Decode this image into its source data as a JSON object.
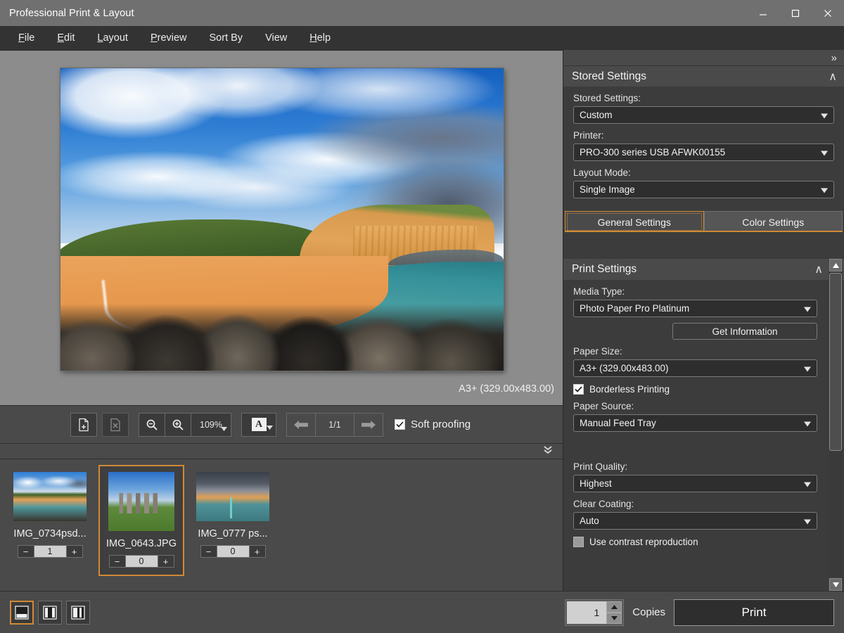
{
  "window": {
    "title": "Professional Print & Layout",
    "minimize_label": "Minimize",
    "maximize_label": "Maximize",
    "close_label": "Close"
  },
  "menubar": {
    "items": [
      {
        "label": "File",
        "accel": "F"
      },
      {
        "label": "Edit",
        "accel": "E"
      },
      {
        "label": "Layout",
        "accel": "L"
      },
      {
        "label": "Preview",
        "accel": "P"
      },
      {
        "label": "Sort By",
        "accel": ""
      },
      {
        "label": "View",
        "accel": ""
      },
      {
        "label": "Help",
        "accel": "H"
      }
    ]
  },
  "preview": {
    "paper_size_label": "A3+ (329.00x483.00)",
    "image_alt": "Coastal beach with orange sandstone cliff, teal sea and rock breakwater"
  },
  "toolbar": {
    "add_page_label": "Add Page",
    "delete_page_label": "Delete Page",
    "zoom_out_label": "Zoom Out",
    "zoom_in_label": "Zoom In",
    "zoom_value": "109%",
    "orientation_label": "A",
    "prev_page_label": "Previous Page",
    "next_page_label": "Next Page",
    "page_indicator": "1/1",
    "soft_proofing_label": "Soft proofing",
    "soft_proofing_checked": true
  },
  "thumbnails": {
    "items": [
      {
        "name": "IMG_0734psd...",
        "count": "1",
        "selected": false,
        "art": "t-beach"
      },
      {
        "name": "IMG_0643.JPG",
        "count": "0",
        "selected": true,
        "art": "t-stone"
      },
      {
        "name": "IMG_0777 ps...",
        "count": "0",
        "selected": false,
        "art": "t-storm"
      }
    ],
    "minus_label": "−",
    "plus_label": "+"
  },
  "right_panel": {
    "expand_label": "»",
    "stored_settings": {
      "header": "Stored Settings",
      "collapse_label": "∧",
      "fields": [
        {
          "label": "Stored Settings:",
          "value": "Custom"
        },
        {
          "label": "Printer:",
          "value": "PRO-300 series USB AFWK00155"
        },
        {
          "label": "Layout Mode:",
          "value": "Single Image"
        }
      ]
    },
    "tabs": [
      {
        "label": "General Settings",
        "active": true
      },
      {
        "label": "Color Settings",
        "active": false
      }
    ],
    "print_settings": {
      "header": "Print Settings",
      "collapse_label": "∧",
      "media_type_label": "Media Type:",
      "media_type_value": "Photo Paper Pro Platinum",
      "get_information_label": "Get Information",
      "paper_size_label": "Paper Size:",
      "paper_size_value": "A3+ (329.00x483.00)",
      "borderless_label": "Borderless Printing",
      "borderless_checked": true,
      "paper_source_label": "Paper Source:",
      "paper_source_value": "Manual Feed Tray",
      "print_quality_label": "Print Quality:",
      "print_quality_value": "Highest",
      "clear_coating_label": "Clear Coating:",
      "clear_coating_value": "Auto",
      "contrast_label": "Use contrast reproduction",
      "contrast_checked": false
    }
  },
  "bottom": {
    "view_modes": [
      {
        "name": "single-view",
        "active": true
      },
      {
        "name": "split-view",
        "active": false
      },
      {
        "name": "thumbnail-view",
        "active": false
      }
    ],
    "copies_value": "1",
    "copies_label": "Copies",
    "print_label": "Print"
  },
  "colors": {
    "accent": "#d08a35",
    "titlebar": "#707070",
    "menubar": "#333333",
    "panel": "#3c3c3c",
    "panel_header": "#4a4a4a",
    "canvas": "#8c8c8c"
  }
}
